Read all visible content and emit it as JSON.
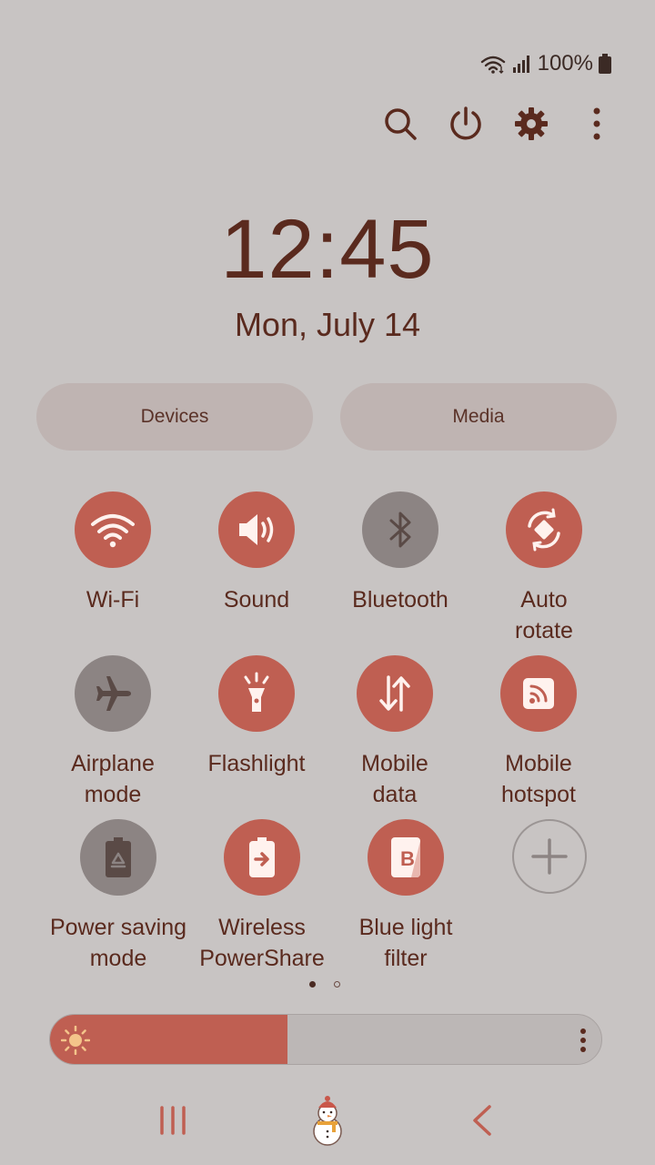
{
  "status": {
    "battery_text": "100%"
  },
  "clock": {
    "time": "12:45",
    "date": "Mon, July 14"
  },
  "panels": {
    "devices_label": "Devices",
    "media_label": "Media"
  },
  "tiles": [
    {
      "label": "Wi-Fi",
      "icon": "wifi-icon",
      "on": true
    },
    {
      "label": "Sound",
      "icon": "speaker-icon",
      "on": true
    },
    {
      "label": "Bluetooth",
      "icon": "bluetooth-icon",
      "on": false
    },
    {
      "label": "Auto\nrotate",
      "icon": "auto-rotate-icon",
      "on": true
    },
    {
      "label": "Airplane\nmode",
      "icon": "airplane-icon",
      "on": false
    },
    {
      "label": "Flashlight",
      "icon": "flashlight-icon",
      "on": true
    },
    {
      "label": "Mobile\ndata",
      "icon": "mobile-data-icon",
      "on": true
    },
    {
      "label": "Mobile\nhotspot",
      "icon": "hotspot-icon",
      "on": true
    },
    {
      "label": "Power saving\nmode",
      "icon": "power-saving-icon",
      "on": false
    },
    {
      "label": "Wireless\nPowerShare",
      "icon": "wireless-powershare-icon",
      "on": true
    },
    {
      "label": "Blue light\nfilter",
      "icon": "blue-light-filter-icon",
      "on": true
    },
    {
      "label": "",
      "icon": "add-icon",
      "on": false
    }
  ],
  "brightness": {
    "level": 0.43
  },
  "colors": {
    "accent": "#bf5f52",
    "text": "#5a2a1e",
    "background": "#c8c4c3"
  }
}
